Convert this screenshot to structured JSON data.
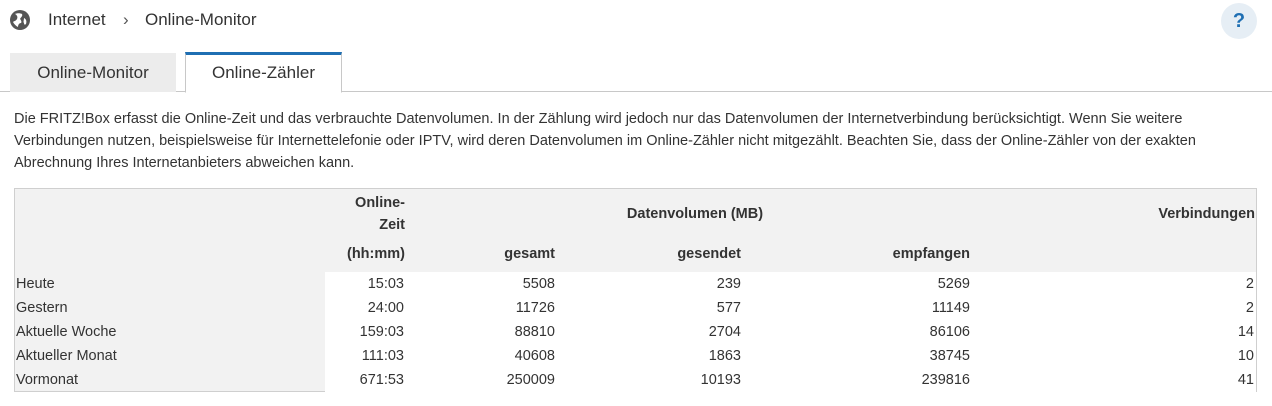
{
  "breadcrumb": {
    "section": "Internet",
    "separator": "›",
    "page": "Online-Monitor"
  },
  "help_label": "?",
  "tabs": [
    {
      "label": "Online-Monitor",
      "active": false
    },
    {
      "label": "Online-Zähler",
      "active": true
    }
  ],
  "description": "Die FRITZ!Box erfasst die Online-Zeit und das verbrauchte Datenvolumen. In der Zählung wird jedoch nur das Datenvolumen der Internetverbindung berücksichtigt. Wenn Sie weitere Verbindungen nutzen, beispielsweise für Internettelefonie oder IPTV, wird deren Datenvolumen im Online-Zähler nicht mitgezählt. Beachten Sie, dass der Online-Zähler von der exakten Abrechnung Ihres Internetanbieters abweichen kann.",
  "table": {
    "headers": {
      "online_time": "Online-Zeit",
      "online_time_unit": "(hh:mm)",
      "data_volume": "Datenvolumen (MB)",
      "total": "gesamt",
      "sent": "gesendet",
      "received": "empfangen",
      "connections": "Verbindungen"
    },
    "rows": [
      {
        "label": "Heute",
        "time": "15:03",
        "total": "5508",
        "sent": "239",
        "received": "5269",
        "connections": "2"
      },
      {
        "label": "Gestern",
        "time": "24:00",
        "total": "11726",
        "sent": "577",
        "received": "11149",
        "connections": "2"
      },
      {
        "label": "Aktuelle Woche",
        "time": "159:03",
        "total": "88810",
        "sent": "2704",
        "received": "86106",
        "connections": "14"
      },
      {
        "label": "Aktueller Monat",
        "time": "111:03",
        "total": "40608",
        "sent": "1863",
        "received": "38745",
        "connections": "10"
      },
      {
        "label": "Vormonat",
        "time": "671:53",
        "total": "250009",
        "sent": "10193",
        "received": "239816",
        "connections": "41"
      }
    ]
  },
  "colors": {
    "accent": "#1f6fb3",
    "tab_inactive_bg": "#ececec",
    "table_header_bg": "#f2f2f2"
  }
}
